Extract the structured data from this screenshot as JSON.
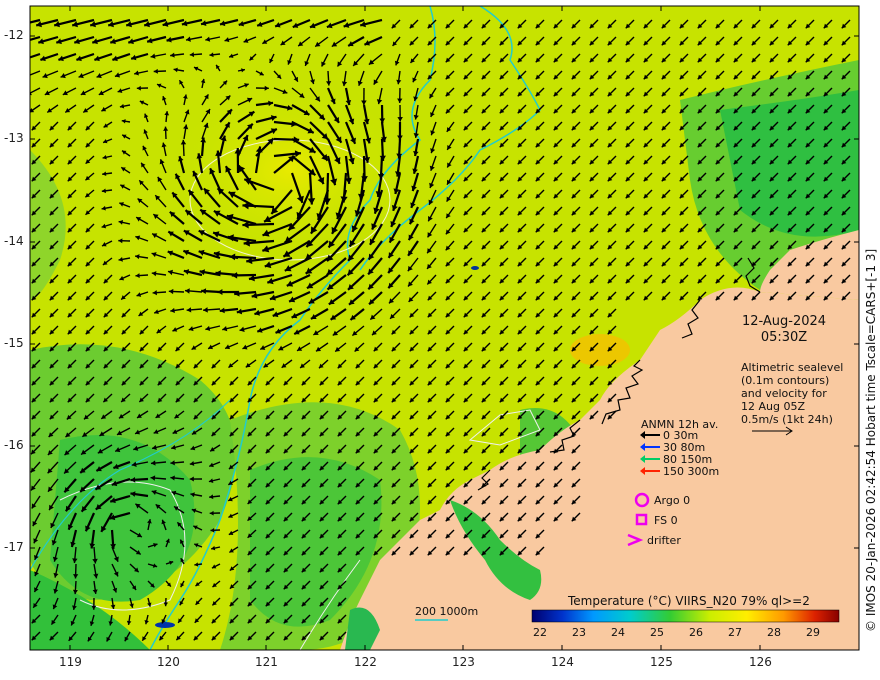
{
  "map": {
    "lon_ticks": [
      "119",
      "120",
      "121",
      "122",
      "123",
      "124",
      "125",
      "126"
    ],
    "lat_ticks": [
      "-12",
      "-13",
      "-14",
      "-15",
      "-16",
      "-17"
    ],
    "date": "12-Aug-2024",
    "time": "05:30Z",
    "altimetry_note": [
      "Altimetric sealevel",
      "(0.1m contours)",
      "and velocity for",
      "12 Aug 05Z",
      "0.5m/s (1kt 24h)"
    ],
    "anmn_title": "ANMN 12h av.",
    "anmn_items": [
      {
        "label": "0 30m",
        "color": "#000000"
      },
      {
        "label": "30 80m",
        "color": "#0033ff"
      },
      {
        "label": "80 150m",
        "color": "#00cc66"
      },
      {
        "label": "150 300m",
        "color": "#ff2200"
      }
    ],
    "argo_label": "Argo 0",
    "fs_label": "FS 0",
    "drifter_label": "drifter",
    "depth_contour_label": "200  1000m",
    "colorbar_title": "Temperature (°C) VIIRS_N20 79% ql>=2",
    "colorbar_ticks": [
      "22",
      "23",
      "24",
      "25",
      "26",
      "27",
      "28",
      "29"
    ],
    "credit": "© IMOS 20-Jan-2026 02:42:54 Hobart time Tscale=CARS+[-1 3]",
    "colors": {
      "land": "#f9c9a0",
      "sea_warm": "#d8e600",
      "sea_mid": "#9fd821",
      "sea_cool": "#33c445",
      "contour": "#22cccc",
      "marker": "#ee00ee"
    }
  }
}
